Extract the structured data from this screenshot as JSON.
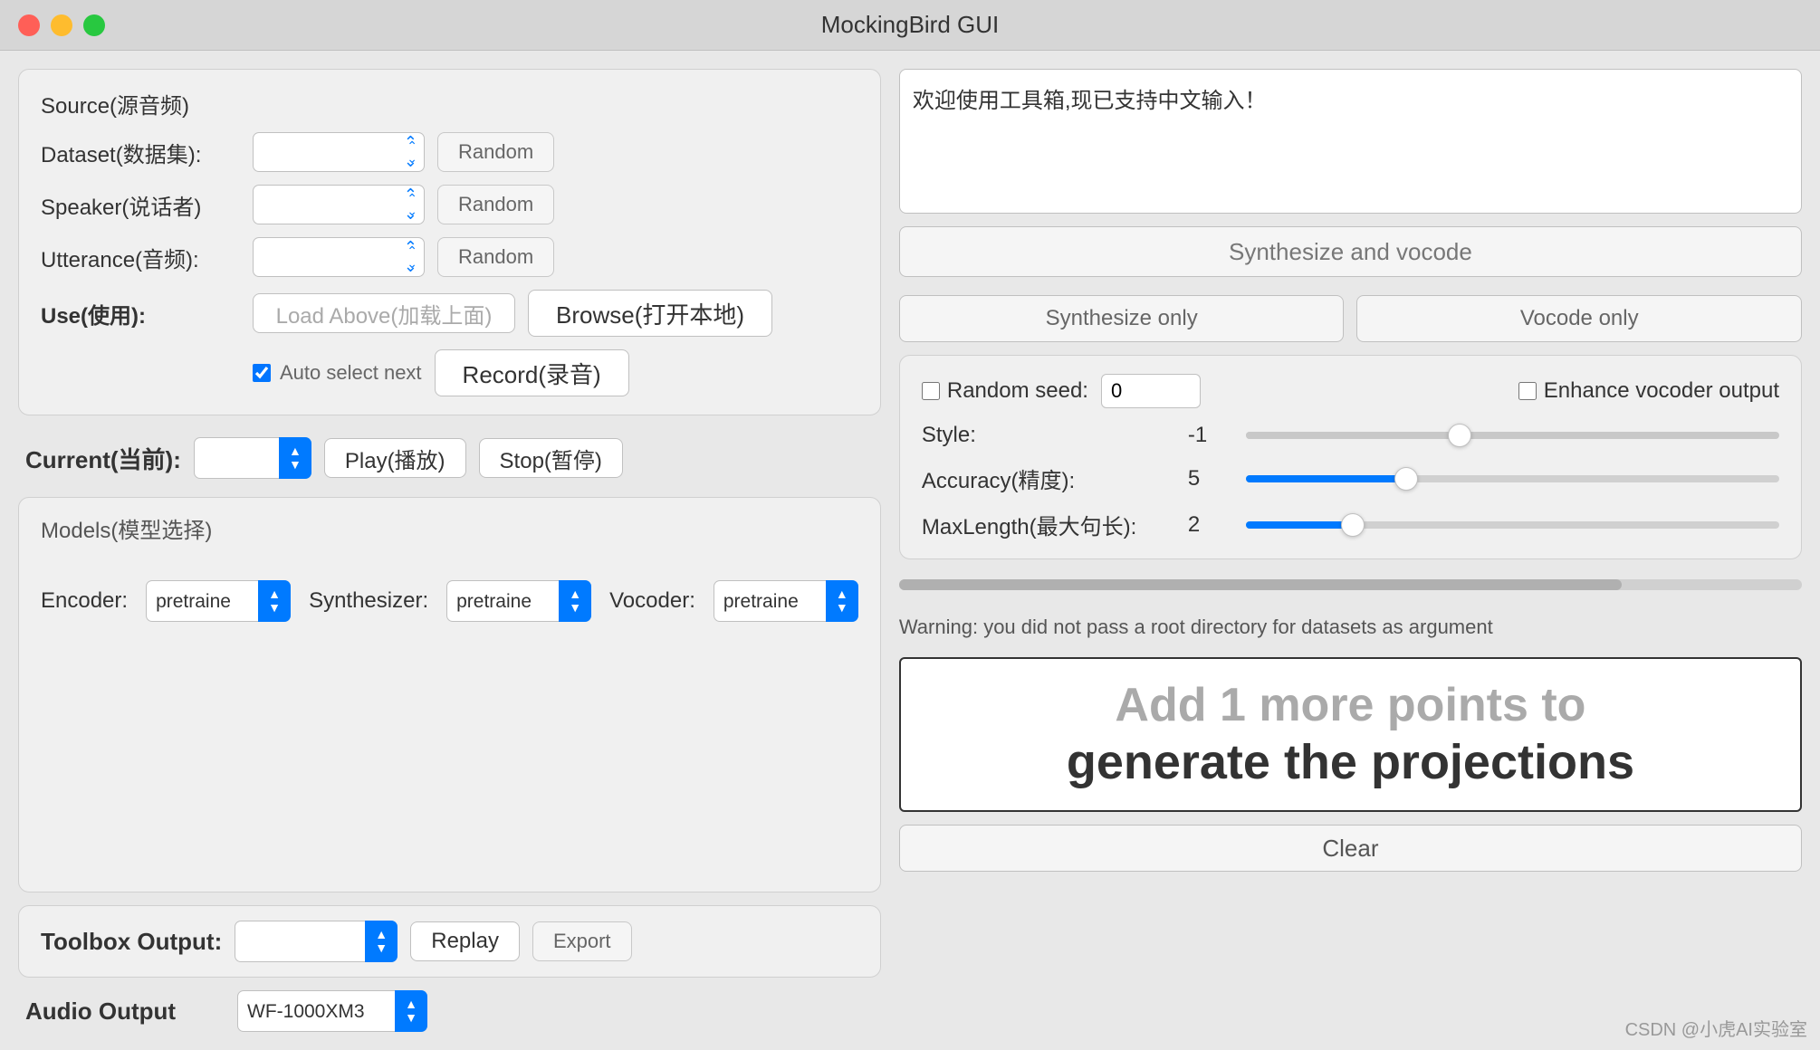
{
  "window": {
    "title": "MockingBird GUI"
  },
  "left": {
    "source_label": "Source(源音频)",
    "dataset_label": "Dataset(数据集):",
    "speaker_label": "Speaker(说话者)",
    "utterance_label": "Utterance(音频):",
    "use_label": "Use(使用):",
    "random_btn": "Random",
    "load_above_btn": "Load Above(加载上面)",
    "browse_btn": "Browse(打开本地)",
    "record_btn": "Record(录音)",
    "auto_select": "Auto select next",
    "current_label": "Current(当前):",
    "play_btn": "Play(播放)",
    "stop_btn": "Stop(暂停)",
    "models_label": "Models(模型选择)",
    "encoder_label": "Encoder:",
    "encoder_value": "pretraine",
    "synthesizer_label": "Synthesizer:",
    "synthesizer_value": "pretraine",
    "vocoder_label": "Vocoder:",
    "vocoder_value": "pretraine"
  },
  "toolbox": {
    "label": "Toolbox Output:",
    "replay_btn": "Replay",
    "export_btn": "Export",
    "audio_label": "Audio Output",
    "audio_value": "WF-1000XM3"
  },
  "right": {
    "text_content": "欢迎使用工具箱,现已支持中文输入！",
    "synth_vocode_btn": "Synthesize and vocode",
    "synth_only_btn": "Synthesize only",
    "vocode_only_btn": "Vocode only",
    "random_seed_label": "Random seed:",
    "random_seed_value": "0",
    "enhance_label": "Enhance vocoder output",
    "style_label": "Style:",
    "style_value": "-1",
    "accuracy_label": "Accuracy(精度):",
    "accuracy_value": "5",
    "maxlength_label": "MaxLength(最大句长):",
    "maxlength_value": "2",
    "warning_text": "Warning: you did not pass a root directory for datasets as argument",
    "output_faded": "Add 1 more points to",
    "output_main": "generate the projections",
    "clear_btn": "Clear",
    "watermark": "CSDN @小虎AI实验室"
  }
}
